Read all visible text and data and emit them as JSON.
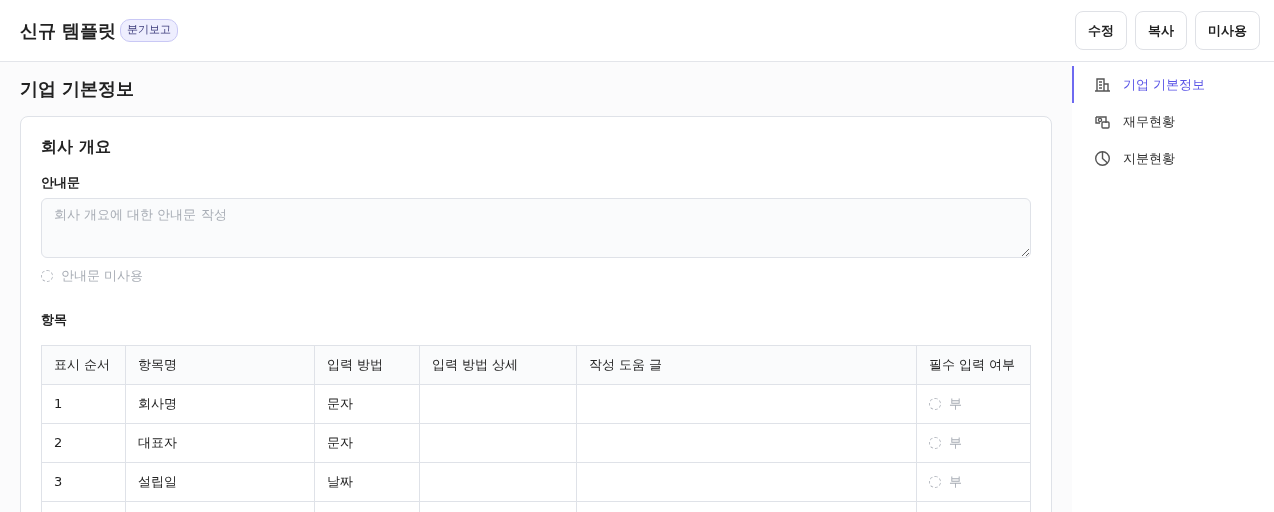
{
  "header": {
    "title": "신규 템플릿",
    "badge": "분기보고",
    "buttons": [
      "수정",
      "복사",
      "미사용"
    ]
  },
  "section": {
    "title": "기업 기본정보"
  },
  "card": {
    "title": "회사 개요",
    "guide_label": "안내문",
    "guide_placeholder": "회사 개요에 대한 안내문 작성",
    "guide_toggle": {
      "label": "안내문 미사용",
      "on": false
    },
    "items_label": "항목"
  },
  "table": {
    "columns": [
      "표시 순서",
      "항목명",
      "입력 방법",
      "입력 방법 상세",
      "작성 도움 글",
      "필수 입력 여부"
    ],
    "rows": [
      {
        "order": "1",
        "name": "회사명",
        "method": "문자",
        "required": {
          "label": "부",
          "on": false
        }
      },
      {
        "order": "2",
        "name": "대표자",
        "method": "문자",
        "required": {
          "label": "부",
          "on": false
        }
      },
      {
        "order": "3",
        "name": "설립일",
        "method": "날짜",
        "required": {
          "label": "부",
          "on": false
        }
      }
    ]
  },
  "sidebar": {
    "items": [
      {
        "label": "기업 기본정보",
        "kind": "building",
        "selected": true
      },
      {
        "label": "재무현황",
        "kind": "money",
        "selected": false
      },
      {
        "label": "지분현황",
        "kind": "pie",
        "selected": false
      }
    ]
  }
}
